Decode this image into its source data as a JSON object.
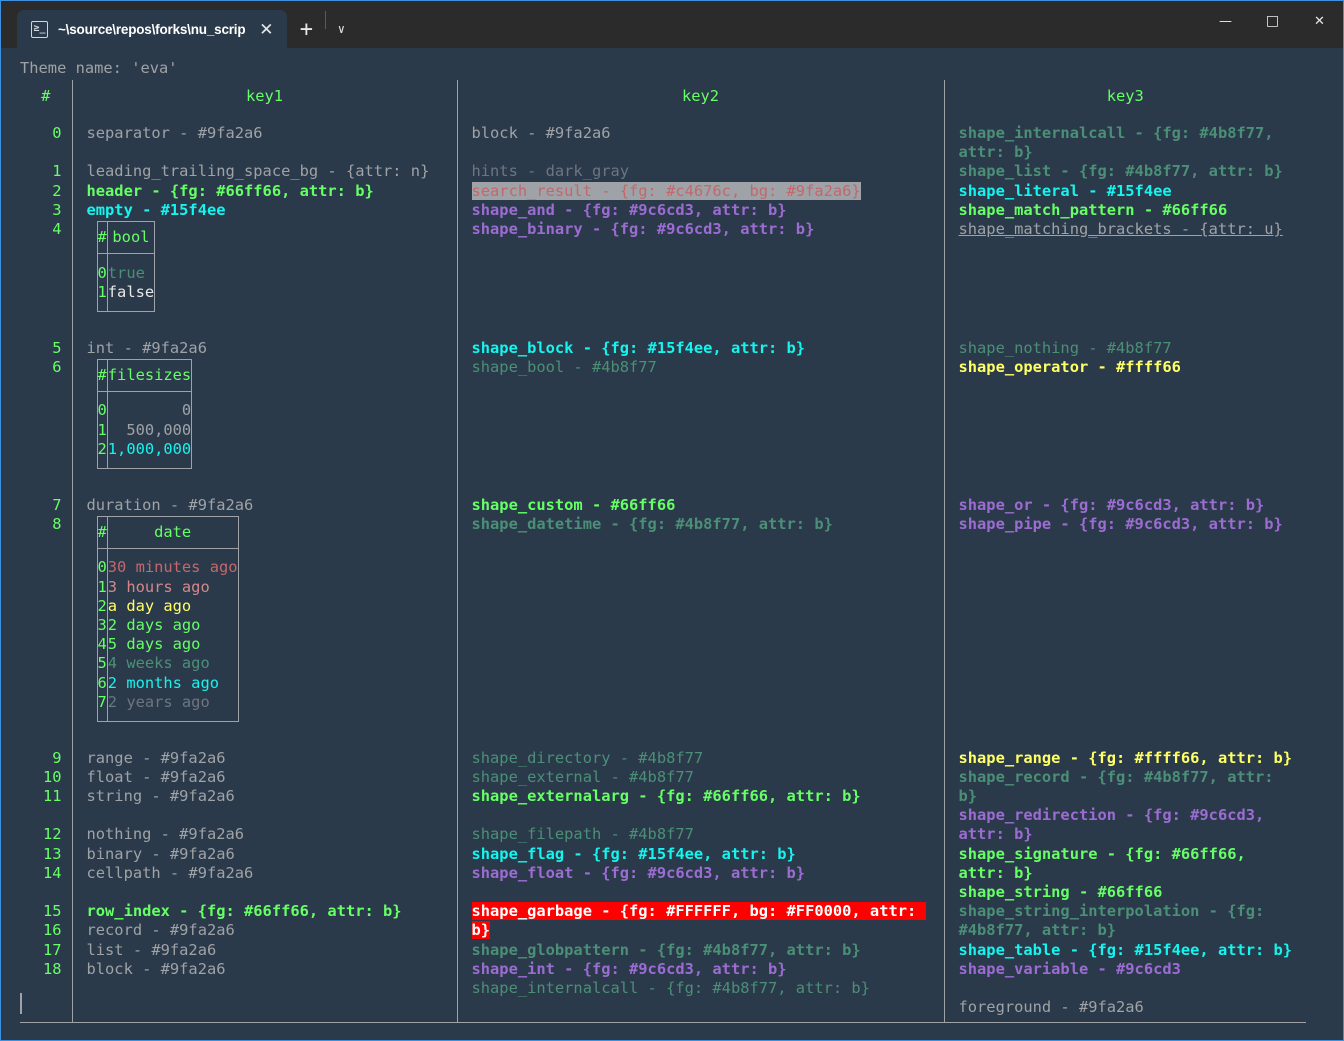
{
  "window": {
    "tab_title": "~\\source\\repos\\forks\\nu_scrip",
    "tab_icon": "terminal-icon",
    "close_glyph": "✕",
    "new_tab_glyph": "+",
    "chevron_glyph": "∨",
    "minimize_glyph": "—",
    "maximize_glyph": "□",
    "close_window_glyph": "✕"
  },
  "terminal": {
    "theme_line": "Theme name: 'eva'",
    "prompt_cursor": "|"
  },
  "table": {
    "headers": [
      "#",
      "key1",
      "key2",
      "key3"
    ],
    "row_groups": [
      {
        "indices": [
          "0",
          "",
          "1",
          "2",
          "3",
          "4"
        ],
        "key1": [
          {
            "text": "separator - #9fa2a6",
            "style": "gray"
          },
          {
            "text": "",
            "style": "blank"
          },
          {
            "text": "leading_trailing_space_bg - {attr: n}",
            "style": "gray"
          },
          {
            "text": "header - {fg: #66ff66, attr: b}",
            "style": "green"
          },
          {
            "text": "empty - #15f4ee",
            "style": "cyan"
          },
          {
            "nested": "bool"
          }
        ],
        "key2": [
          {
            "text": "block - #9fa2a6",
            "style": "gray"
          },
          {
            "text": "",
            "style": "blank"
          },
          {
            "text": "hints - dark_gray",
            "style": "dgray"
          },
          {
            "text": "search_result - {fg: #c4676c, bg: #9fa2a6}",
            "style": "hl-gray"
          },
          {
            "text": "shape_and - {fg: #9c6cd3, attr: b}",
            "style": "purple"
          },
          {
            "text": "shape_binary - {fg: #9c6cd3, attr: b}",
            "style": "purple"
          }
        ],
        "key3": [
          {
            "text": "shape_internalcall - {fg: #4b8f77, attr: b}",
            "style": "mgreenb"
          },
          {
            "text": "shape_list - {fg: #4b8f77, attr: b}",
            "style": "mgreenb"
          },
          {
            "text": "shape_literal - #15f4ee",
            "style": "cyan"
          },
          {
            "text": "shape_match_pattern - #66ff66",
            "style": "green"
          },
          {
            "text": "shape_matching_brackets - {attr: u}",
            "style": "uline"
          }
        ]
      },
      {
        "indices": [
          "5",
          "6"
        ],
        "key1": [
          {
            "text": "int - #9fa2a6",
            "style": "gray"
          },
          {
            "nested": "filesizes"
          }
        ],
        "key2": [
          {
            "text": "shape_block - {fg: #15f4ee, attr: b}",
            "style": "cyan"
          },
          {
            "text": "shape_bool - #4b8f77",
            "style": "mgreen"
          }
        ],
        "key3": [
          {
            "text": "shape_nothing - #4b8f77",
            "style": "mgreen"
          },
          {
            "text": "shape_operator - #ffff66",
            "style": "yellow"
          }
        ]
      },
      {
        "indices": [
          "7",
          "8"
        ],
        "key1": [
          {
            "text": "duration - #9fa2a6",
            "style": "gray"
          },
          {
            "nested": "date"
          }
        ],
        "key2": [
          {
            "text": "shape_custom - #66ff66",
            "style": "green"
          },
          {
            "text": "shape_datetime - {fg: #4b8f77, attr: b}",
            "style": "mgreenb"
          }
        ],
        "key3": [
          {
            "text": "shape_or - {fg: #9c6cd3, attr: b}",
            "style": "purple"
          },
          {
            "text": "shape_pipe - {fg: #9c6cd3, attr: b}",
            "style": "purple"
          }
        ]
      },
      {
        "indices": [
          "9",
          "10",
          "11",
          "",
          "12",
          "13",
          "14",
          "",
          "15",
          "16",
          "17",
          "18"
        ],
        "key1": [
          {
            "text": "range - #9fa2a6",
            "style": "gray"
          },
          {
            "text": "float - #9fa2a6",
            "style": "gray"
          },
          {
            "text": "string - #9fa2a6",
            "style": "gray"
          },
          {
            "text": "",
            "style": "blank"
          },
          {
            "text": "nothing - #9fa2a6",
            "style": "gray"
          },
          {
            "text": "binary - #9fa2a6",
            "style": "gray"
          },
          {
            "text": "cellpath - #9fa2a6",
            "style": "gray"
          },
          {
            "text": "",
            "style": "blank"
          },
          {
            "text": "row_index - {fg: #66ff66, attr: b}",
            "style": "green"
          },
          {
            "text": "record - #9fa2a6",
            "style": "gray"
          },
          {
            "text": "list - #9fa2a6",
            "style": "gray"
          },
          {
            "text": "block - #9fa2a6",
            "style": "gray"
          }
        ],
        "key2": [
          {
            "text": "shape_directory - #4b8f77",
            "style": "mgreen"
          },
          {
            "text": "shape_external - #4b8f77",
            "style": "mgreen"
          },
          {
            "text": "shape_externalarg - {fg: #66ff66, attr: b}",
            "style": "green"
          },
          {
            "text": "",
            "style": "blank"
          },
          {
            "text": "shape_filepath - #4b8f77",
            "style": "mgreen"
          },
          {
            "text": "shape_flag - {fg: #15f4ee, attr: b}",
            "style": "cyan"
          },
          {
            "text": "shape_float - {fg: #9c6cd3, attr: b}",
            "style": "purple"
          },
          {
            "text": "",
            "style": "blank"
          },
          {
            "text": "shape_garbage - {fg: #FFFFFF, bg: #FF0000, attr: b}",
            "style": "hl-red"
          },
          {
            "text": "shape_globpattern - {fg: #4b8f77, attr: b}",
            "style": "mgreenb"
          },
          {
            "text": "shape_int - {fg: #9c6cd3, attr: b}",
            "style": "purple"
          },
          {
            "text": "shape_internalcall - {fg: #4b8f77, attr: b}",
            "style": "mgreen"
          }
        ],
        "key3": [
          {
            "text": "shape_range - {fg: #ffff66, attr: b}",
            "style": "yellow"
          },
          {
            "text": "shape_record - {fg: #4b8f77, attr: b}",
            "style": "mgreenb"
          },
          {
            "text": "shape_redirection - {fg: #9c6cd3, attr: b}",
            "style": "purple"
          },
          {
            "text": "shape_signature - {fg: #66ff66, attr: b}",
            "style": "green"
          },
          {
            "text": "shape_string - #66ff66",
            "style": "green"
          },
          {
            "text": "shape_string_interpolation - {fg: #4b8f77, attr: b}",
            "style": "mgreenb"
          },
          {
            "text": "shape_table - {fg: #15f4ee, attr: b}",
            "style": "cyan"
          },
          {
            "text": "shape_variable - #9c6cd3",
            "style": "purple"
          },
          {
            "text": "",
            "style": "blank"
          },
          {
            "text": "foreground - #9fa2a6",
            "style": "gray"
          }
        ]
      }
    ]
  },
  "nested_tables": {
    "bool": {
      "headers": [
        "#",
        "bool"
      ],
      "rows": [
        {
          "idx": "0",
          "value": "true",
          "style": "mgreen",
          "align": "left"
        },
        {
          "idx": "1",
          "value": "false",
          "style": "white",
          "align": "left"
        }
      ]
    },
    "filesizes": {
      "headers": [
        "#",
        "filesizes"
      ],
      "rows": [
        {
          "idx": "0",
          "value": "0",
          "style": "gray",
          "align": "right"
        },
        {
          "idx": "1",
          "value": "500,000",
          "style": "gray",
          "align": "right"
        },
        {
          "idx": "2",
          "value": "1,000,000",
          "style": "cyan",
          "align": "right"
        }
      ]
    },
    "date": {
      "headers": [
        "#",
        "date"
      ],
      "rows": [
        {
          "idx": "0",
          "value": "30 minutes ago",
          "style": "salmon",
          "align": "left"
        },
        {
          "idx": "1",
          "value": "3 hours ago",
          "style": "pink",
          "align": "left"
        },
        {
          "idx": "2",
          "value": "a day ago",
          "style": "yellow",
          "align": "left"
        },
        {
          "idx": "3",
          "value": "2 days ago",
          "style": "green",
          "align": "left"
        },
        {
          "idx": "4",
          "value": "5 days ago",
          "style": "green",
          "align": "left"
        },
        {
          "idx": "5",
          "value": "4 weeks ago",
          "style": "mgreen",
          "align": "left"
        },
        {
          "idx": "6",
          "value": "2 months ago",
          "style": "cyan",
          "align": "left"
        },
        {
          "idx": "7",
          "value": "2 years ago",
          "style": "dgray",
          "align": "left"
        }
      ]
    }
  },
  "colors": {
    "background": "#2b3a4a",
    "border": "#9fa2a6",
    "accent_green": "#66ff66",
    "accent_cyan": "#15f4ee",
    "accent_purple": "#9c6cd3",
    "accent_yellow": "#ffff66",
    "error_bg": "#ff0000",
    "window_border": "#3e91e0"
  }
}
